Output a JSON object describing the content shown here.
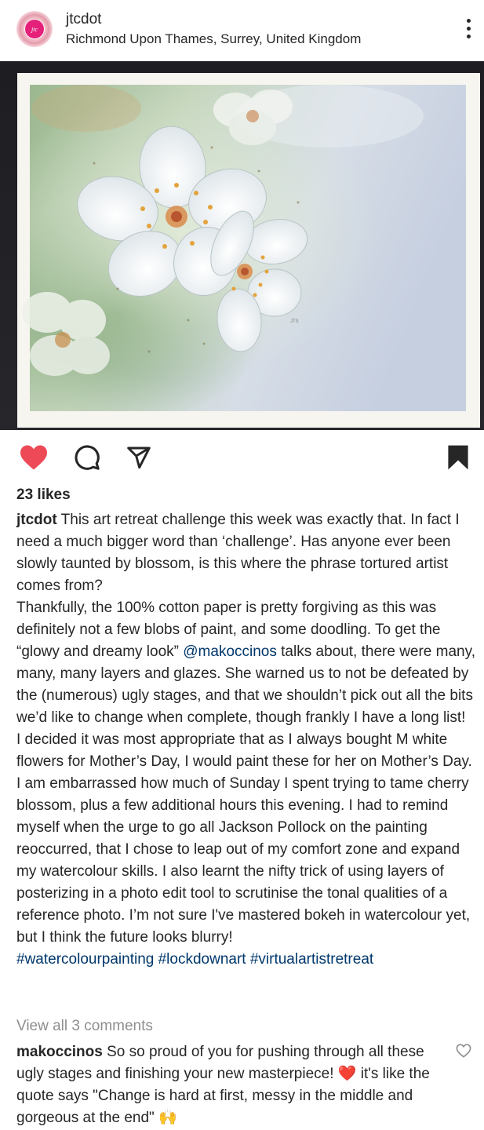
{
  "post": {
    "username": "jtcdot",
    "location": "Richmond Upon Thames, Surrey, United Kingdom",
    "avatar_initials": "jtc"
  },
  "icons": {
    "more": "more-vertical-icon",
    "like": "heart-filled-icon",
    "comment": "comment-icon",
    "share": "send-icon",
    "save": "bookmark-filled-icon",
    "comment_like": "heart-outline-icon"
  },
  "colors": {
    "like_red": "#ed4956",
    "link": "#00376b",
    "muted": "#8e8e8e"
  },
  "painting": {
    "signature": "JTS"
  },
  "likes": "23 likes",
  "caption": {
    "username": "jtcdot",
    "para1": "This art retreat challenge this week was exactly that. In fact I need a much bigger word than ‘challenge’. Has anyone ever been slowly taunted by blossom, is this where the phrase tortured artist comes from?",
    "para2_before": "Thankfully, the 100% cotton paper is pretty forgiving as this was definitely not a few blobs of paint, and some doodling.  To get the “glowy and dreamy look” ",
    "mention": "@makoccinos",
    "para2_after": " talks about, there were many, many, many layers and glazes. She warned us to not be defeated by the (numerous) ugly stages, and that we shouldn’t pick out all the bits we’d like to change when complete, though frankly I have a long list!",
    "para3": "I decided it was most appropriate that as I always bought M white flowers for Mother’s Day, I would paint these for her on Mother’s Day. I am embarrassed how much of Sunday I spent trying to tame cherry blossom, plus a few additional hours this evening.  I had to remind myself when the urge to go all Jackson Pollock on the painting reoccurred, that I chose to leap out of my comfort zone and expand my watercolour skills.  I also learnt the nifty trick of using layers of posterizing in a photo edit tool to scrutinise the tonal qualities of a reference photo. I’m not sure I've mastered bokeh in watercolour yet, but I think the future looks blurry!",
    "hashtags": "#watercolourpainting #lockdownart #virtualartistretreat"
  },
  "view_all_comments": "View all 3 comments",
  "top_comment": {
    "username": "makoccinos",
    "text": "So so proud of you for pushing through all these ugly stages and finishing your new masterpiece! ❤️ it's like the quote says \"Change is hard at first, messy in the middle and gorgeous at the end\" 🙌"
  }
}
